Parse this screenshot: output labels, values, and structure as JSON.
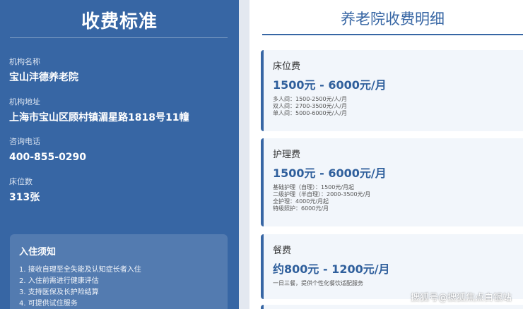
{
  "left": {
    "title": "收费标准",
    "info": [
      {
        "label": "机构名称",
        "value": "宝山沣德养老院"
      },
      {
        "label": "机构地址",
        "value": "上海市宝山区顾村镇湄星路1818号11幢"
      },
      {
        "label": "咨询电话",
        "value": "400-855-0290"
      },
      {
        "label": "床位数",
        "value": "313张"
      }
    ],
    "notice": {
      "title": "入住须知",
      "items": [
        "1. 接收自理至全失能及认知症长者入住",
        "2. 入住前需进行健康评估",
        "3. 支持医保及长护险结算",
        "4. 可提供试住服务"
      ]
    }
  },
  "right": {
    "title": "养老院收费明细",
    "cards": [
      {
        "label": "床位费",
        "price": "1500元 - 6000元/月",
        "details": [
          "多人间：1500-2500元/人/月",
          "双人间：2700-3500元/人/月",
          "单人间：5000-6000元/人/月"
        ]
      },
      {
        "label": "护理费",
        "price": "1500元 - 6000元/月",
        "details": [
          "基础护理（自理）：1500元/月起",
          "二级护理（半自理）：2000-3500元/月",
          "全护理：4000元/月起",
          "特级照护：6000元/月"
        ]
      },
      {
        "label": "餐费",
        "price": "约800元 - 1200元/月",
        "details": [
          "一日三餐，提供个性化餐饮适配服务"
        ]
      }
    ]
  },
  "watermark": "搜狐号@搜狐焦点白银站",
  "colors": {
    "primary": "#3766a4",
    "price": "#2f5f9c",
    "card_bg": "#f2f6fb"
  }
}
